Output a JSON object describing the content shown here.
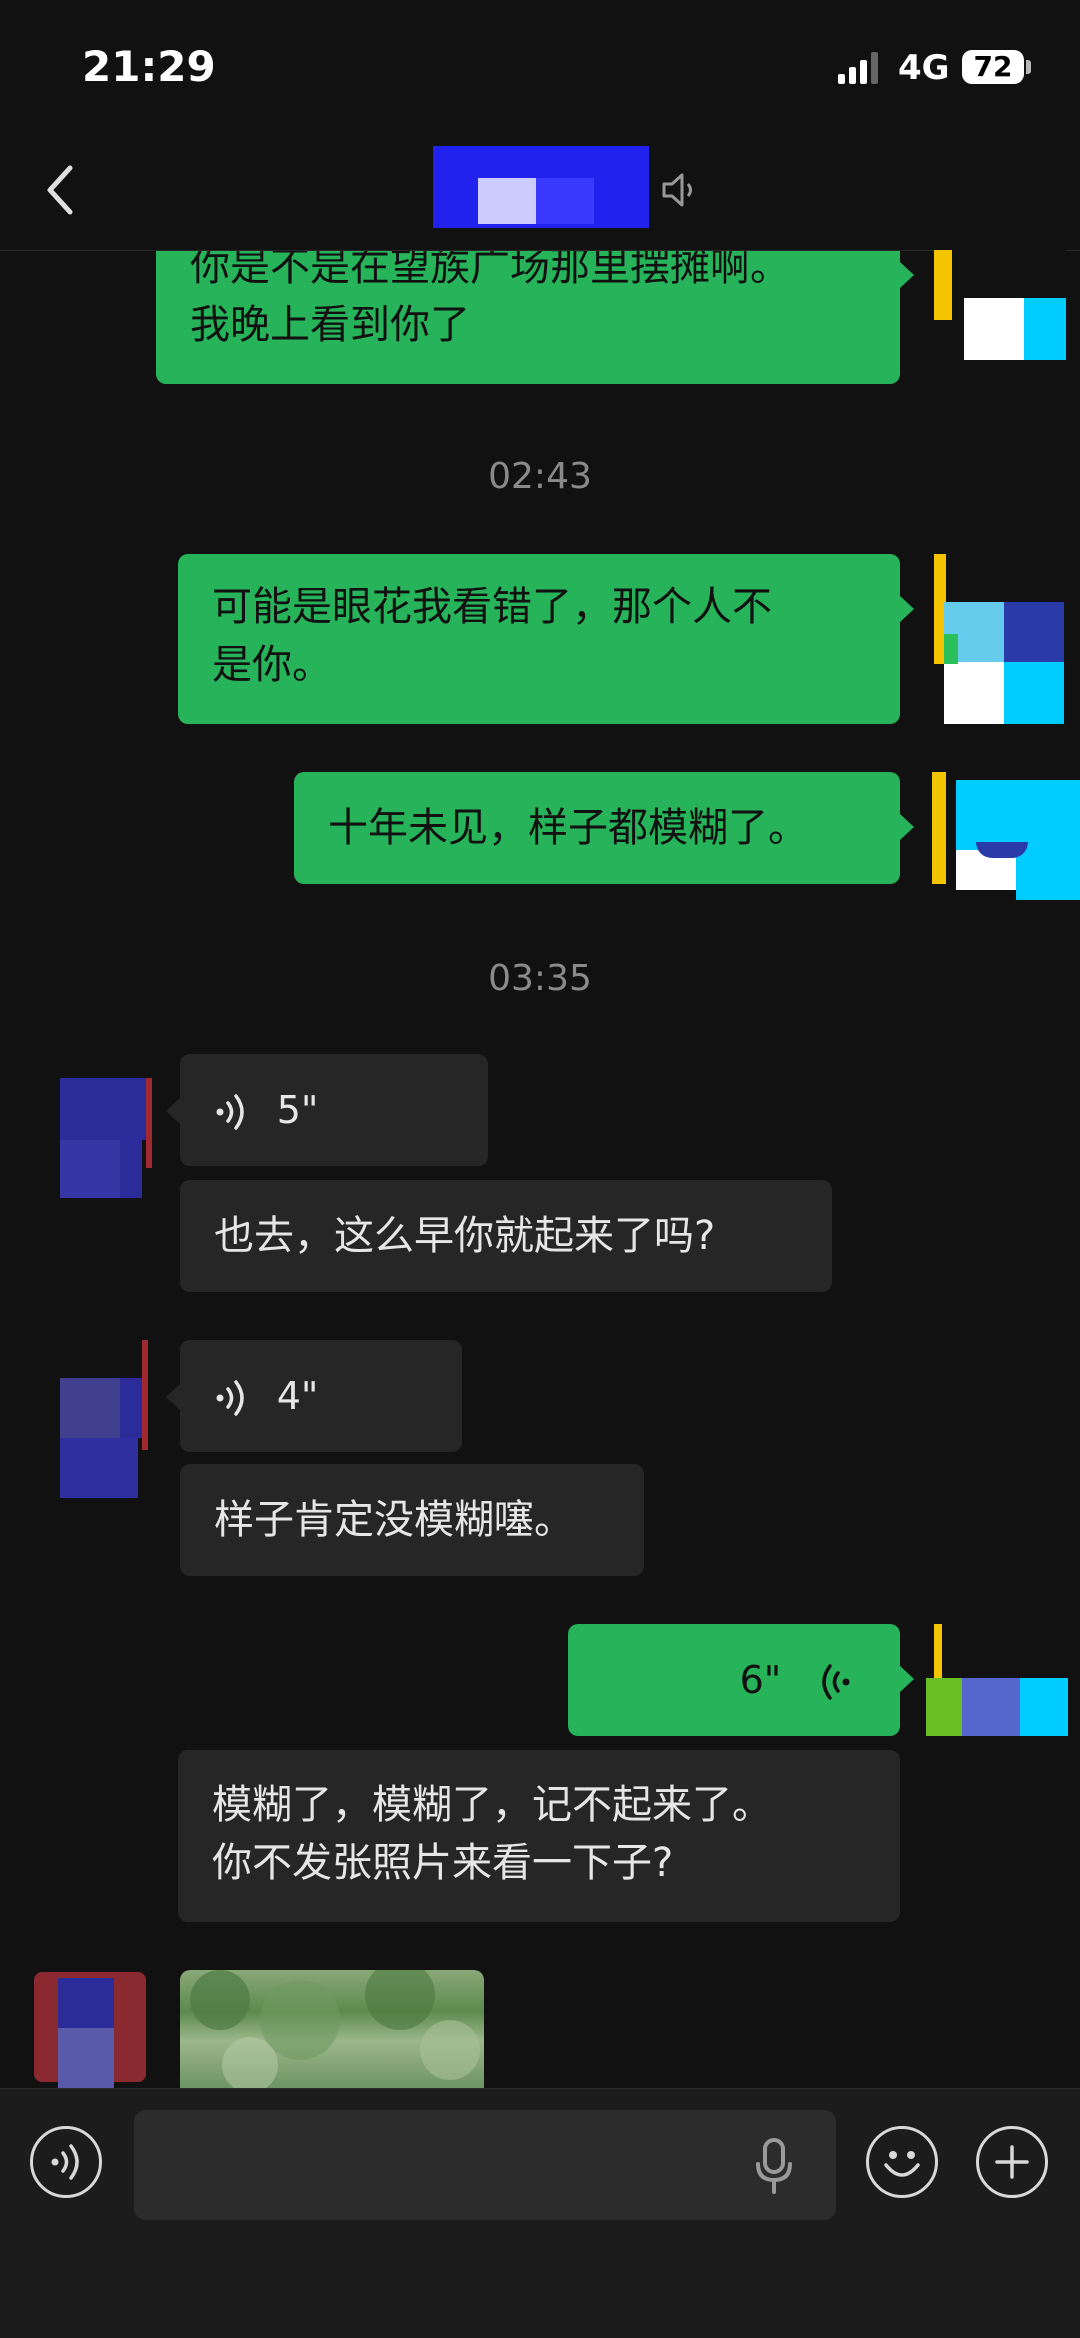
{
  "status": {
    "time": "21:29",
    "network": "4G",
    "battery": "72"
  },
  "header": {
    "title": ""
  },
  "messages": {
    "m1_line1": "你是不是在望族广场那里摆摊啊。",
    "m1_line2": "我晚上看到你了",
    "ts1": "02:43",
    "m2_line1": "可能是眼花我看错了，那个人不",
    "m2_line2": "是你。",
    "m3": "十年未见，样子都模糊了。",
    "ts2": "03:35",
    "v1": "5\"",
    "m4": "也去，这么早你就起来了吗?",
    "v2": "4\"",
    "m5": "样子肯定没模糊噻。",
    "v3": "6\"",
    "m6_line1": "模糊了，模糊了，记不起来了。",
    "m6_line2": "你不发张照片来看一下子?"
  },
  "input": {
    "placeholder": ""
  },
  "colors": {
    "outgoing": "#27b35a",
    "incoming": "#262626",
    "background": "#111111"
  },
  "icons": [
    "back-icon",
    "mute-icon",
    "voice-icon",
    "mic-icon",
    "emoji-icon",
    "plus-icon"
  ]
}
